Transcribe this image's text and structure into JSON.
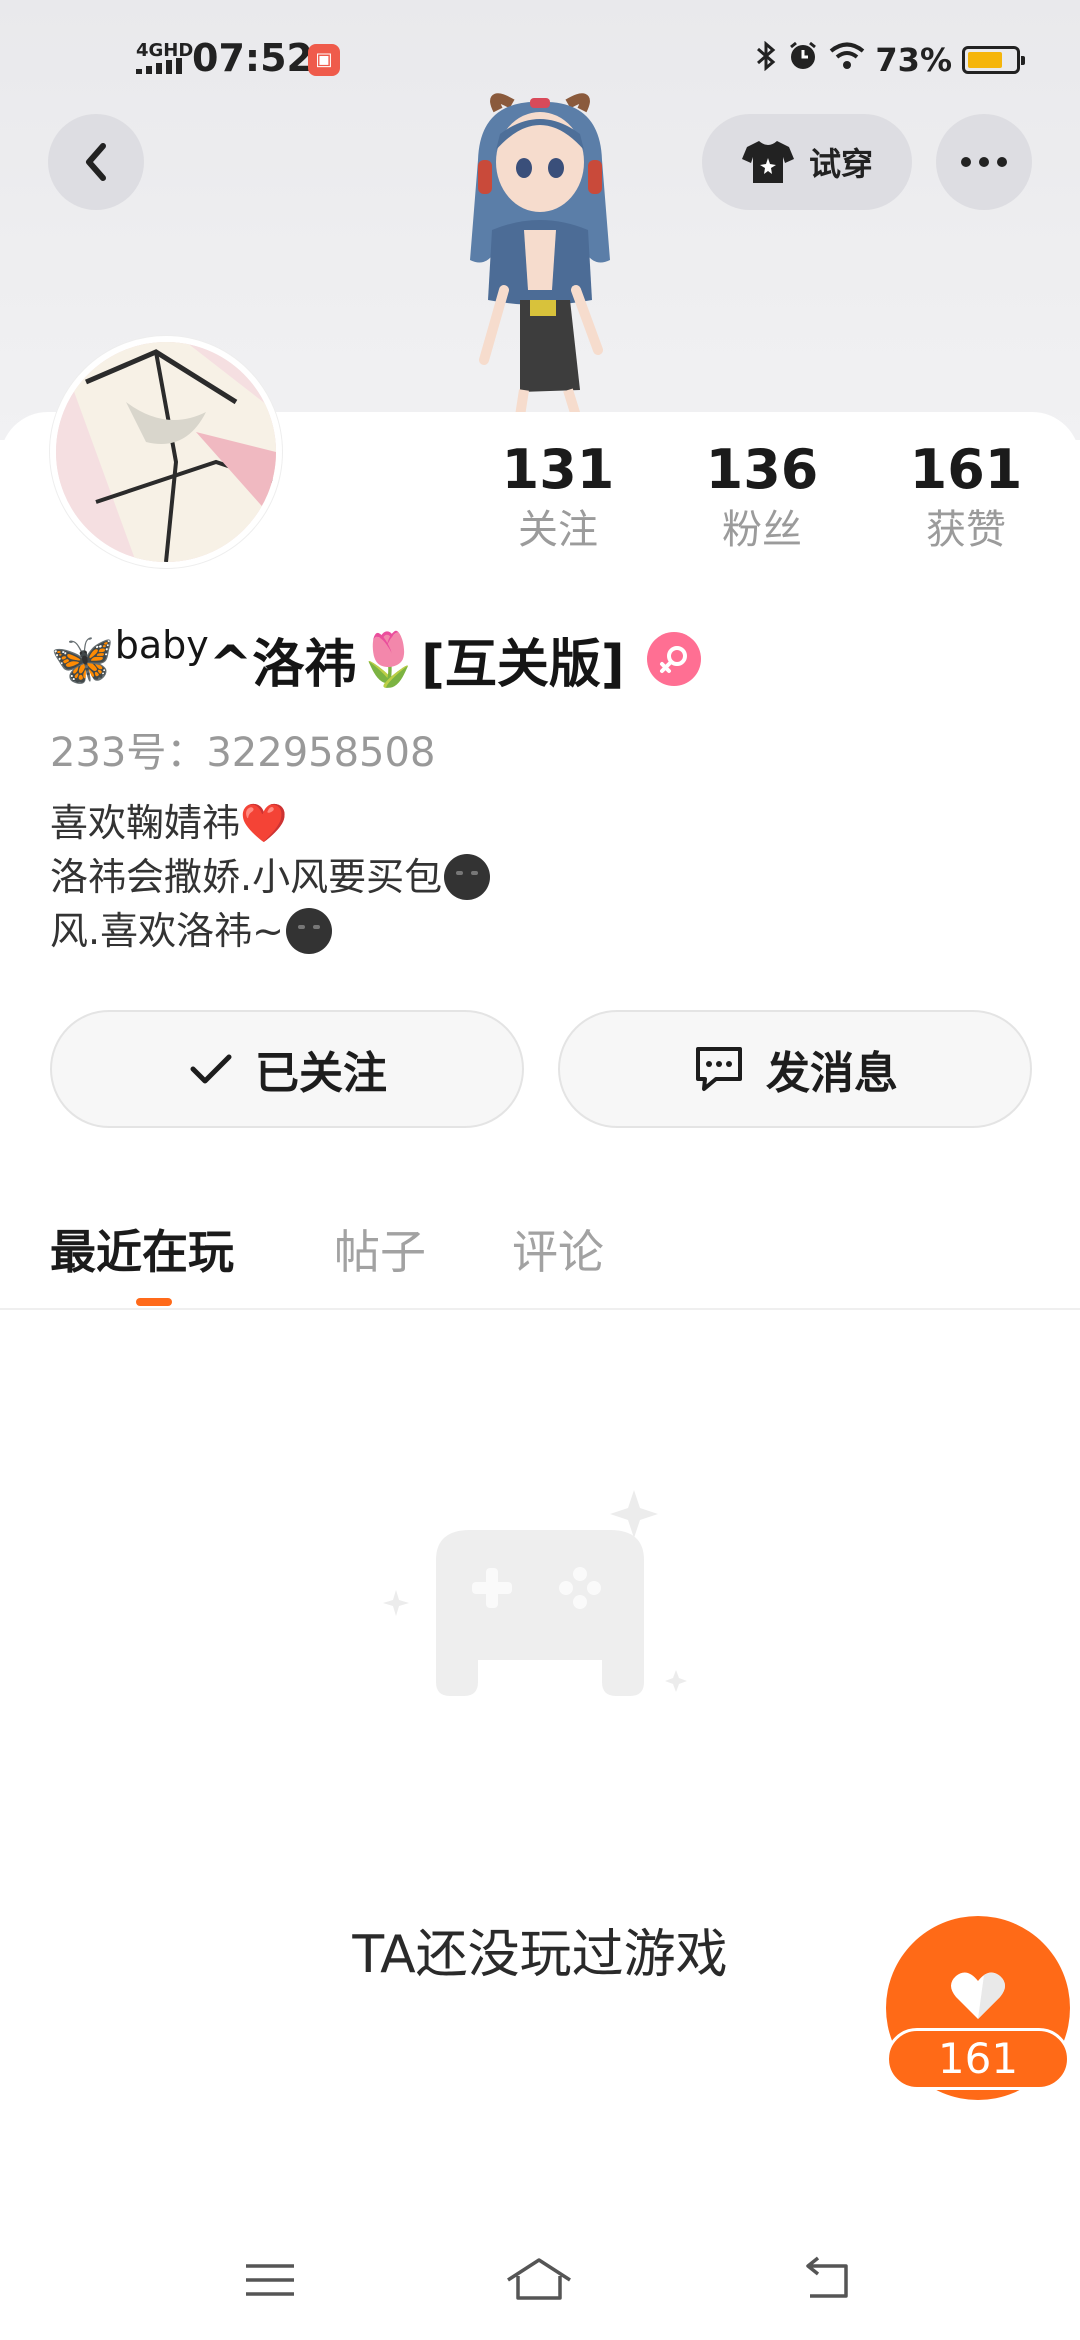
{
  "status_bar": {
    "network": "4GHD",
    "time": "07:52",
    "app_icon": "app-notification-icon",
    "icons": [
      "bluetooth-icon",
      "alarm-icon",
      "wifi-icon"
    ],
    "battery": "73%",
    "battery_level": 0.73,
    "battery_color": "#f5b50b"
  },
  "header": {
    "tryon_label": "试穿"
  },
  "profile": {
    "stats": [
      {
        "value": "131",
        "label": "关注"
      },
      {
        "value": "136",
        "label": "粉丝"
      },
      {
        "value": "161",
        "label": "获赞"
      }
    ],
    "nickname_parts": {
      "emoji_start": "🦋",
      "sup": "baby",
      "main": "^洛祎",
      "emoji_mid": "🌷",
      "suffix": "[互关版]"
    },
    "gender_color": "#ff6f93",
    "uid": "233号：322958508",
    "bio": {
      "line1": "喜欢鞠婧祎❤️",
      "line2": "洛祎会撒娇.小风要买包",
      "line3": "风.喜欢洛祎~"
    }
  },
  "actions": {
    "follow_label": "已关注",
    "message_label": "发消息"
  },
  "tabs": [
    "最近在玩",
    "帖子",
    "评论"
  ],
  "empty_state": {
    "text": "TA还没玩过游戏"
  },
  "like_fab": {
    "count": "161",
    "color": "#ff6a17"
  },
  "accent_color": "#ff6a1a"
}
